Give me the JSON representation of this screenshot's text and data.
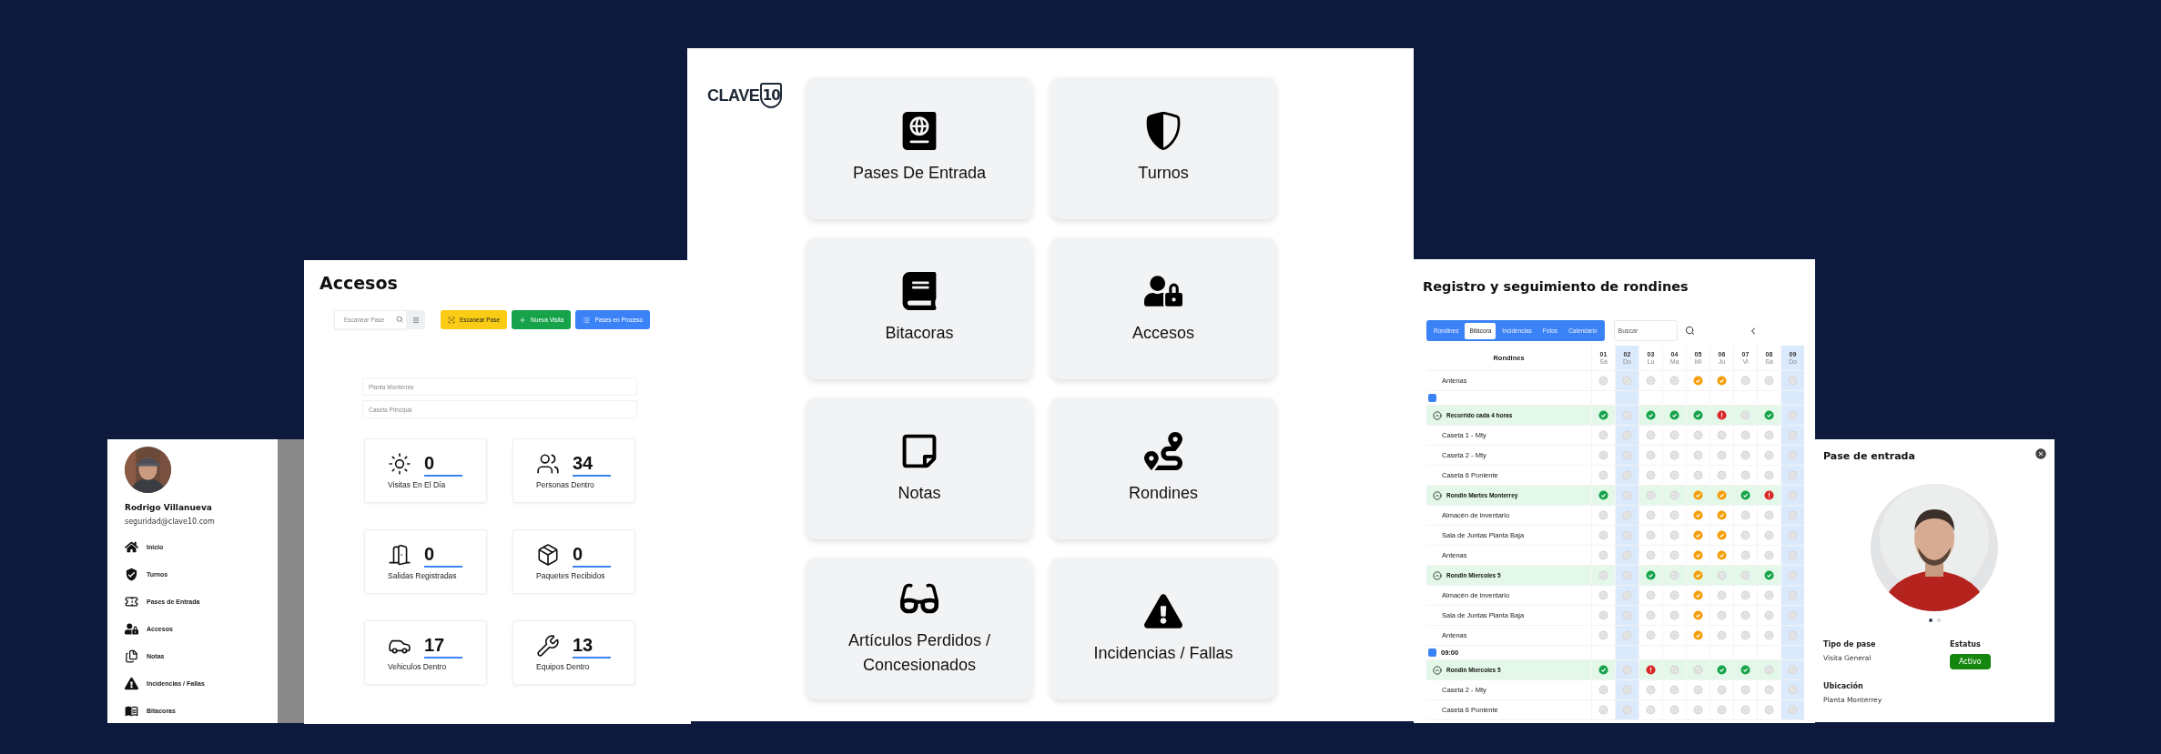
{
  "hub": {
    "logo": {
      "word": "CLAVE",
      "number": "10"
    },
    "modules": [
      {
        "label": "Pases De Entrada"
      },
      {
        "label": "Turnos"
      },
      {
        "label": "Bitacoras"
      },
      {
        "label": "Accesos"
      },
      {
        "label": "Notas"
      },
      {
        "label": "Rondines"
      },
      {
        "label": "Artículos Perdidos / Concesionados"
      },
      {
        "label": "Incidencias / Fallas"
      }
    ]
  },
  "accesos": {
    "title": "Accesos",
    "search": {
      "placeholder": "Escanear Pase"
    },
    "buttons": [
      {
        "label": "Escanear Pase",
        "kind": "scan"
      },
      {
        "label": "Nueva Visita",
        "kind": "new"
      },
      {
        "label": "Pases en Proceso",
        "kind": "list"
      }
    ],
    "fields": [
      {
        "placeholder": "Planta Monterrey"
      },
      {
        "placeholder": "Caseta Principal"
      }
    ],
    "stats": [
      {
        "value": "0",
        "label": "Visitas En El Día"
      },
      {
        "value": "34",
        "label": "Personas Dentro"
      },
      {
        "value": "0",
        "label": "Salidas Registradas"
      },
      {
        "value": "0",
        "label": "Paquetes Recibidos"
      },
      {
        "value": "17",
        "label": "Vehiculos Dentro"
      },
      {
        "value": "13",
        "label": "Equipos Dentro"
      }
    ]
  },
  "sidebar": {
    "user": {
      "name": "Rodrigo Villanueva",
      "email": "seguridad@clave10.com"
    },
    "items": [
      {
        "label": "Inicio"
      },
      {
        "label": "Turnos"
      },
      {
        "label": "Pases de Entrada"
      },
      {
        "label": "Accesos"
      },
      {
        "label": "Notas"
      },
      {
        "label": "Incidencias / Fallas"
      },
      {
        "label": "Bitacoras"
      }
    ]
  },
  "rondines": {
    "title": "Registro y seguimiento de rondines",
    "tabs": [
      {
        "label": "Rondines",
        "selected": false
      },
      {
        "label": "Bitácora",
        "selected": true
      },
      {
        "label": "Incidencias",
        "selected": false
      },
      {
        "label": "Fotos",
        "selected": false
      },
      {
        "label": "Calendario",
        "selected": false
      }
    ],
    "search": {
      "placeholder": "Buscar"
    },
    "table": {
      "name_header": "Rondines",
      "days": [
        {
          "date": "01",
          "weekday": "Sá",
          "highlighted": false
        },
        {
          "date": "02",
          "weekday": "Do",
          "highlighted": true
        },
        {
          "date": "03",
          "weekday": "Lu",
          "highlighted": false
        },
        {
          "date": "04",
          "weekday": "Ma",
          "highlighted": false
        },
        {
          "date": "05",
          "weekday": "Mi",
          "highlighted": false
        },
        {
          "date": "06",
          "weekday": "Ju",
          "highlighted": false
        },
        {
          "date": "07",
          "weekday": "Vi",
          "highlighted": false
        },
        {
          "date": "08",
          "weekday": "Sá",
          "highlighted": false
        },
        {
          "date": "09",
          "weekday": "Do",
          "highlighted": true
        }
      ],
      "rows": [
        {
          "kind": "item",
          "name": "Antenas",
          "cells": [
            {
              "kind": "none"
            },
            {
              "kind": "none"
            },
            {
              "kind": "none"
            },
            {
              "kind": "none"
            },
            {
              "kind": "partial"
            },
            {
              "kind": "partial"
            },
            {
              "kind": "none"
            },
            {
              "kind": "none"
            },
            {
              "kind": "none"
            }
          ]
        },
        {
          "kind": "time"
        },
        {
          "kind": "group",
          "name": "Recorrido cada 4 horas",
          "expanded": true,
          "cells": [
            {
              "kind": "done"
            },
            {
              "kind": "none"
            },
            {
              "kind": "done"
            },
            {
              "kind": "done"
            },
            {
              "kind": "done"
            },
            {
              "kind": "failed"
            },
            {
              "kind": "none"
            },
            {
              "kind": "done"
            },
            {
              "kind": "none"
            }
          ]
        },
        {
          "kind": "item",
          "name": "Caseta 1 - Mty",
          "cells": [
            {
              "kind": "none"
            },
            {
              "kind": "none"
            },
            {
              "kind": "none"
            },
            {
              "kind": "none"
            },
            {
              "kind": "none"
            },
            {
              "kind": "none"
            },
            {
              "kind": "none"
            },
            {
              "kind": "none"
            },
            {
              "kind": "none"
            }
          ]
        },
        {
          "kind": "item",
          "name": "Caseta 2 - Mty",
          "cells": [
            {
              "kind": "none"
            },
            {
              "kind": "none"
            },
            {
              "kind": "none"
            },
            {
              "kind": "none"
            },
            {
              "kind": "none"
            },
            {
              "kind": "none"
            },
            {
              "kind": "none"
            },
            {
              "kind": "none"
            },
            {
              "kind": "none"
            }
          ]
        },
        {
          "kind": "item",
          "name": "Caseta 6 Poniente",
          "cells": [
            {
              "kind": "none"
            },
            {
              "kind": "none"
            },
            {
              "kind": "none"
            },
            {
              "kind": "none"
            },
            {
              "kind": "none"
            },
            {
              "kind": "none"
            },
            {
              "kind": "none"
            },
            {
              "kind": "none"
            },
            {
              "kind": "none"
            }
          ]
        },
        {
          "kind": "group",
          "name": "Rondin Martes Monterrey",
          "expanded": true,
          "cells": [
            {
              "kind": "done"
            },
            {
              "kind": "none"
            },
            {
              "kind": "none"
            },
            {
              "kind": "none"
            },
            {
              "kind": "partial"
            },
            {
              "kind": "partial"
            },
            {
              "kind": "done"
            },
            {
              "kind": "failed"
            },
            {
              "kind": "none"
            }
          ]
        },
        {
          "kind": "item",
          "name": "Almacén de inventario",
          "cells": [
            {
              "kind": "none"
            },
            {
              "kind": "none"
            },
            {
              "kind": "none"
            },
            {
              "kind": "none"
            },
            {
              "kind": "partial"
            },
            {
              "kind": "partial"
            },
            {
              "kind": "none"
            },
            {
              "kind": "none"
            },
            {
              "kind": "none"
            }
          ]
        },
        {
          "kind": "item",
          "name": "Sala de Juntas Planta Baja",
          "cells": [
            {
              "kind": "none"
            },
            {
              "kind": "none"
            },
            {
              "kind": "none"
            },
            {
              "kind": "none"
            },
            {
              "kind": "partial"
            },
            {
              "kind": "partial"
            },
            {
              "kind": "none"
            },
            {
              "kind": "none"
            },
            {
              "kind": "none"
            }
          ]
        },
        {
          "kind": "item",
          "name": "Antenas",
          "cells": [
            {
              "kind": "none"
            },
            {
              "kind": "none"
            },
            {
              "kind": "none"
            },
            {
              "kind": "none"
            },
            {
              "kind": "partial"
            },
            {
              "kind": "partial"
            },
            {
              "kind": "none"
            },
            {
              "kind": "none"
            },
            {
              "kind": "none"
            }
          ]
        },
        {
          "kind": "group",
          "name": "Rondin Miercoles 5",
          "expanded": true,
          "cells": [
            {
              "kind": "none"
            },
            {
              "kind": "none"
            },
            {
              "kind": "done"
            },
            {
              "kind": "none"
            },
            {
              "kind": "partial"
            },
            {
              "kind": "none"
            },
            {
              "kind": "none"
            },
            {
              "kind": "done"
            },
            {
              "kind": "none"
            }
          ]
        },
        {
          "kind": "item",
          "name": "Almacén de inventario",
          "cells": [
            {
              "kind": "none"
            },
            {
              "kind": "none"
            },
            {
              "kind": "none"
            },
            {
              "kind": "none"
            },
            {
              "kind": "partial"
            },
            {
              "kind": "none"
            },
            {
              "kind": "none"
            },
            {
              "kind": "none"
            },
            {
              "kind": "none"
            }
          ]
        },
        {
          "kind": "item",
          "name": "Sala de Juntas Planta Baja",
          "cells": [
            {
              "kind": "none"
            },
            {
              "kind": "none"
            },
            {
              "kind": "none"
            },
            {
              "kind": "none"
            },
            {
              "kind": "partial"
            },
            {
              "kind": "none"
            },
            {
              "kind": "none"
            },
            {
              "kind": "none"
            },
            {
              "kind": "none"
            }
          ]
        },
        {
          "kind": "item",
          "name": "Antenas",
          "cells": [
            {
              "kind": "none"
            },
            {
              "kind": "none"
            },
            {
              "kind": "none"
            },
            {
              "kind": "none"
            },
            {
              "kind": "partial"
            },
            {
              "kind": "none"
            },
            {
              "kind": "none"
            },
            {
              "kind": "none"
            },
            {
              "kind": "none"
            }
          ]
        },
        {
          "kind": "time",
          "time": "09:00"
        },
        {
          "kind": "group",
          "name": "Rondin Miercoles 5",
          "expanded": true,
          "cells": [
            {
              "kind": "done"
            },
            {
              "kind": "none"
            },
            {
              "kind": "failed"
            },
            {
              "kind": "none"
            },
            {
              "kind": "none"
            },
            {
              "kind": "done"
            },
            {
              "kind": "done"
            },
            {
              "kind": "none"
            },
            {
              "kind": "none"
            }
          ]
        },
        {
          "kind": "item",
          "name": "Caseta 2 - Mty",
          "cells": [
            {
              "kind": "none"
            },
            {
              "kind": "none"
            },
            {
              "kind": "none"
            },
            {
              "kind": "none"
            },
            {
              "kind": "none"
            },
            {
              "kind": "none"
            },
            {
              "kind": "none"
            },
            {
              "kind": "none"
            },
            {
              "kind": "none"
            }
          ]
        },
        {
          "kind": "item",
          "name": "Caseta 6 Poniente",
          "cells": [
            {
              "kind": "none"
            },
            {
              "kind": "none"
            },
            {
              "kind": "none"
            },
            {
              "kind": "none"
            },
            {
              "kind": "none"
            },
            {
              "kind": "none"
            },
            {
              "kind": "none"
            },
            {
              "kind": "none"
            },
            {
              "kind": "none"
            }
          ]
        }
      ]
    }
  },
  "pase": {
    "title": "Pase de entrada",
    "photo_dots": [
      {
        "selected": true
      },
      {
        "selected": false
      }
    ],
    "tipo": {
      "label": "Tipo de pase",
      "value": "Visita General"
    },
    "estatus": {
      "label": "Estatus",
      "badge": "Activo"
    },
    "ubicacion": {
      "label": "Ubicación",
      "value": "Planta Monterrey"
    }
  }
}
